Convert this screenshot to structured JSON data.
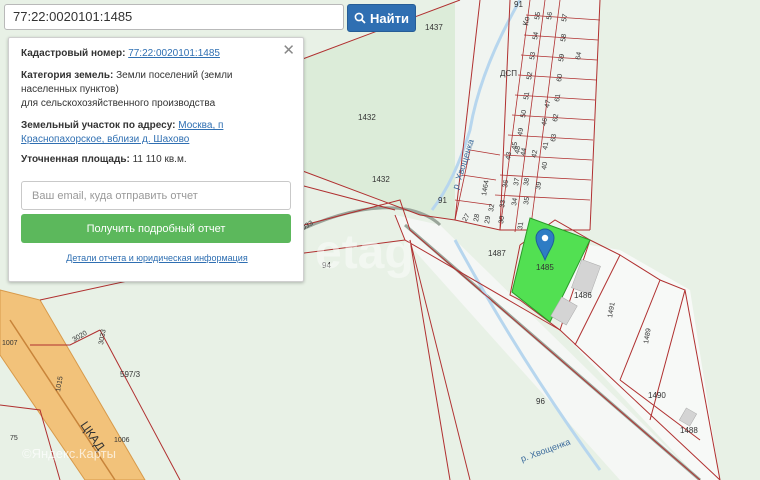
{
  "search": {
    "value": "77:22:0020101:1485",
    "button_label": "Найти"
  },
  "info": {
    "cadastral_label": "Кадастровый номер:",
    "cadastral_value": "77:22:0020101:1485",
    "category_label": "Категория земель:",
    "category_value": "Земли поселений (земли населенных пунктов)",
    "category_value2": "для сельскохозяйственного производства",
    "address_label": "Земельный участок по адресу:",
    "address_value": "Москва, п Краснопахорское, вблизи д. Шахово",
    "area_label": "Уточненная площадь:",
    "area_value": "11 110 кв.м.",
    "email_placeholder": "Ваш email, куда отправить отчет",
    "report_button": "Получить подробный отчет",
    "details_link": "Детали отчета и юридическая информация"
  },
  "map": {
    "colors": {
      "parcel_selected": "#52e052",
      "boundary": "#b03030",
      "background": "#e8f1e6",
      "marker": "#2e7cc4"
    },
    "parcel_labels": {
      "p1437": "1437",
      "p1432a": "1432",
      "p1432b": "1432",
      "p91a": "91",
      "p91b": "91",
      "p94": "94",
      "p3033a": "3033",
      "p3033b": "3033",
      "p3020": "3020",
      "p1007": "1007",
      "p1015": "1015",
      "p5973": "597/3",
      "p75": "75",
      "p1006": "1006",
      "p1487": "1487",
      "p1485": "1485",
      "p1486": "1486",
      "p1491": "1491",
      "p1489": "1489",
      "p1490": "1490",
      "p1488": "1488",
      "p96": "96",
      "p1464": "1464"
    },
    "lot_numbers": [
      "55",
      "54",
      "53",
      "52",
      "51",
      "50",
      "49",
      "48",
      "47",
      "46",
      "45",
      "44",
      "43",
      "42",
      "41",
      "40",
      "39",
      "38",
      "37",
      "36",
      "35",
      "34",
      "33",
      "32",
      "31",
      "30",
      "29",
      "28",
      "27",
      "56",
      "57",
      "58",
      "59",
      "60",
      "61",
      "62",
      "63",
      "64"
    ],
    "river_labels": {
      "top": "р. Хвощенка",
      "bottom": "р. Хвощенка"
    },
    "road_label": "ЦКАД",
    "area_label": "ДСП",
    "street_label": "Ко",
    "watermark": "etag",
    "brand_watermark": "©Яндекс.Карты"
  }
}
